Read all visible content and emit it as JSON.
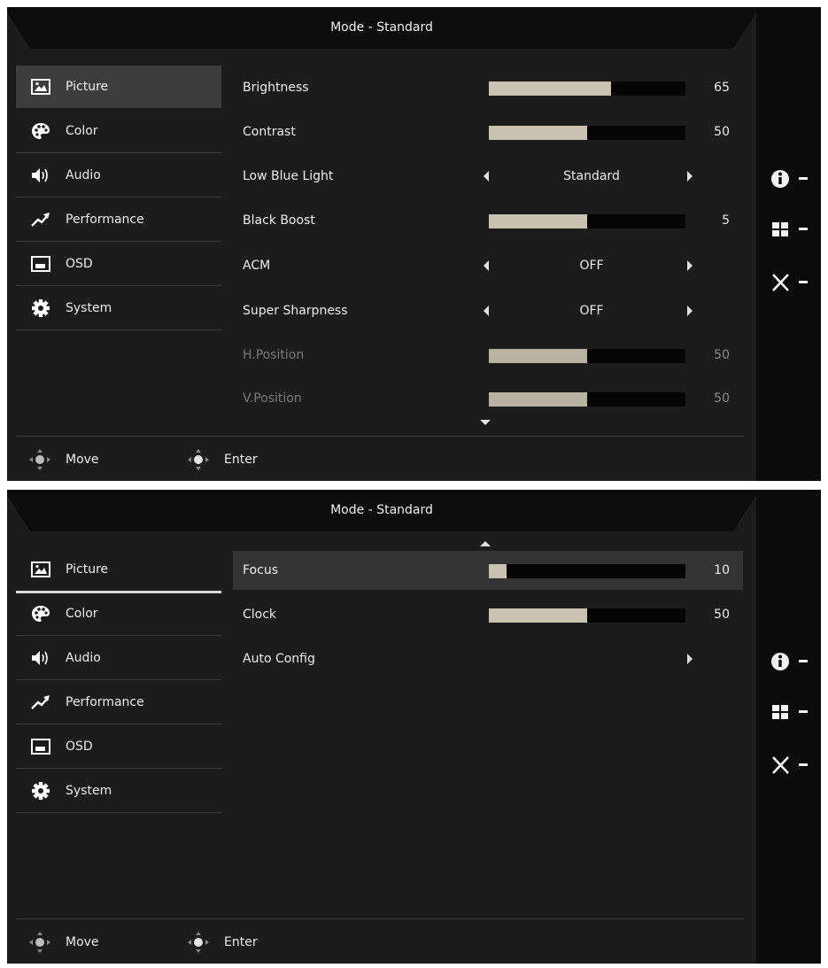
{
  "panels": [
    {
      "header": {
        "title": "Mode - Standard"
      },
      "sidebar": [
        {
          "label": "Picture",
          "icon": "picture-icon"
        },
        {
          "label": "Color",
          "icon": "palette-icon"
        },
        {
          "label": "Audio",
          "icon": "speaker-icon"
        },
        {
          "label": "Performance",
          "icon": "trend-arrow-icon"
        },
        {
          "label": "OSD",
          "icon": "osd-window-icon"
        },
        {
          "label": "System",
          "icon": "gear-icon"
        }
      ],
      "rows": [
        {
          "label": "Brightness",
          "type": "slider",
          "value": "65",
          "level": 0.62
        },
        {
          "label": "Contrast",
          "type": "slider",
          "value": "50",
          "level": 0.5
        },
        {
          "label": "Low Blue Light",
          "type": "option",
          "value": "Standard"
        },
        {
          "label": "Black Boost",
          "type": "slider",
          "value": "5",
          "level": 0.5
        },
        {
          "label": "ACM",
          "type": "option",
          "value": "OFF"
        },
        {
          "label": "Super Sharpness",
          "type": "option",
          "value": "OFF"
        },
        {
          "label": "H.Position",
          "type": "slider",
          "value": "50",
          "level": 0.5,
          "disabled": true
        },
        {
          "label": "V.Position",
          "type": "slider",
          "value": "50",
          "level": 0.5,
          "disabled": true
        }
      ],
      "footer": {
        "move_label": "Move",
        "enter_label": "Enter"
      }
    },
    {
      "header": {
        "title": "Mode - Standard"
      },
      "sidebar": [
        {
          "label": "Picture",
          "icon": "picture-icon"
        },
        {
          "label": "Color",
          "icon": "palette-icon"
        },
        {
          "label": "Audio",
          "icon": "speaker-icon"
        },
        {
          "label": "Performance",
          "icon": "trend-arrow-icon"
        },
        {
          "label": "OSD",
          "icon": "osd-window-icon"
        },
        {
          "label": "System",
          "icon": "gear-icon"
        }
      ],
      "rows": [
        {
          "label": "Focus",
          "type": "slider",
          "value": "10",
          "level": 0.09,
          "selected": true
        },
        {
          "label": "Clock",
          "type": "slider",
          "value": "50",
          "level": 0.5
        },
        {
          "label": "Auto Config",
          "type": "action"
        }
      ],
      "footer": {
        "move_label": "Move",
        "enter_label": "Enter"
      }
    }
  ],
  "hotkeys": [
    {
      "icon": "info-icon"
    },
    {
      "icon": "menu-grid-icon"
    },
    {
      "icon": "close-icon"
    }
  ],
  "colors": {
    "panel_bg": "#1c1c1c",
    "slider_fill": "#c9c2b0",
    "slider_track": "#050505",
    "selected_row": "#333333"
  }
}
